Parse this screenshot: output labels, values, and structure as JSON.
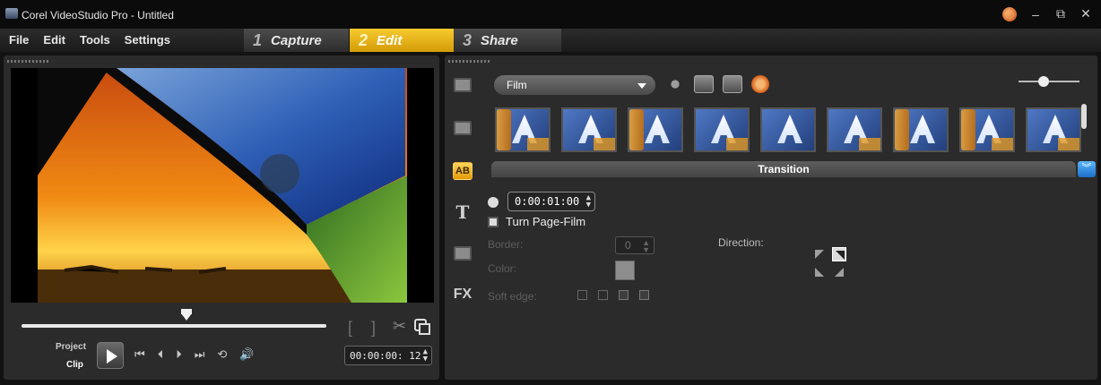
{
  "window": {
    "title": "Corel VideoStudio Pro - Untitled",
    "icon": "app-icon"
  },
  "menu": {
    "items": [
      "File",
      "Edit",
      "Tools",
      "Settings"
    ]
  },
  "steps": [
    {
      "num": "1",
      "label": "Capture",
      "active": false
    },
    {
      "num": "2",
      "label": "Edit",
      "active": true
    },
    {
      "num": "3",
      "label": "Share",
      "active": false
    }
  ],
  "player": {
    "project_label": "Project",
    "clip_label": "Clip",
    "mark_in": "[",
    "mark_out": "]",
    "timecode": "00:00:00: 12"
  },
  "library": {
    "folder": "Film",
    "section_title": "Transition",
    "thumbs": [
      "",
      "",
      "",
      "",
      "",
      "",
      "",
      "",
      ""
    ]
  },
  "options": {
    "duration": "0:00:01:00",
    "effect_name": "Turn Page-Film",
    "border_label": "Border:",
    "border_value": "0",
    "color_label": "Color:",
    "softedge_label": "Soft edge:",
    "direction_label": "Direction:"
  },
  "colors": {
    "accent": "#f3be1e",
    "panel": "#2b2b2b",
    "options_toggle": "#1d6fc8"
  }
}
